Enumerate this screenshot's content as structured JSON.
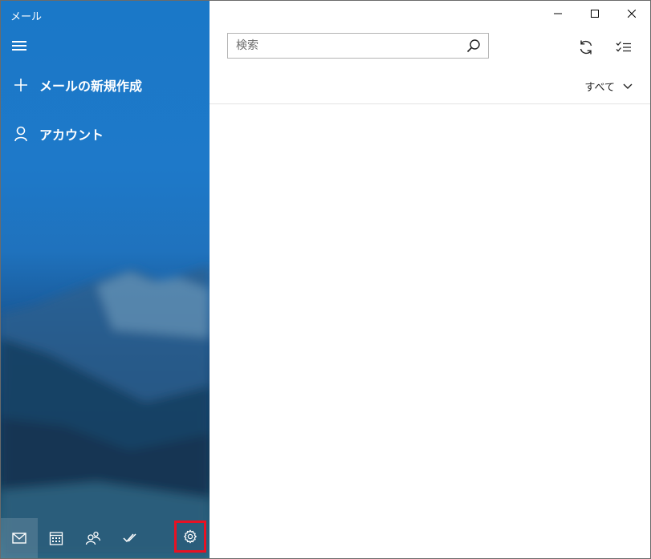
{
  "window": {
    "title": "メール"
  },
  "sidebar": {
    "new_mail_label": "メールの新規作成",
    "account_label": "アカウント"
  },
  "search": {
    "placeholder": "検索"
  },
  "list": {
    "filter_label": "すべて"
  },
  "bottom_nav": [
    "mail-icon",
    "calendar-icon",
    "people-icon",
    "todo-icon",
    "settings-icon"
  ],
  "colors": {
    "sidebar_blue": "#1e79c9",
    "highlight_red": "#e81123"
  }
}
